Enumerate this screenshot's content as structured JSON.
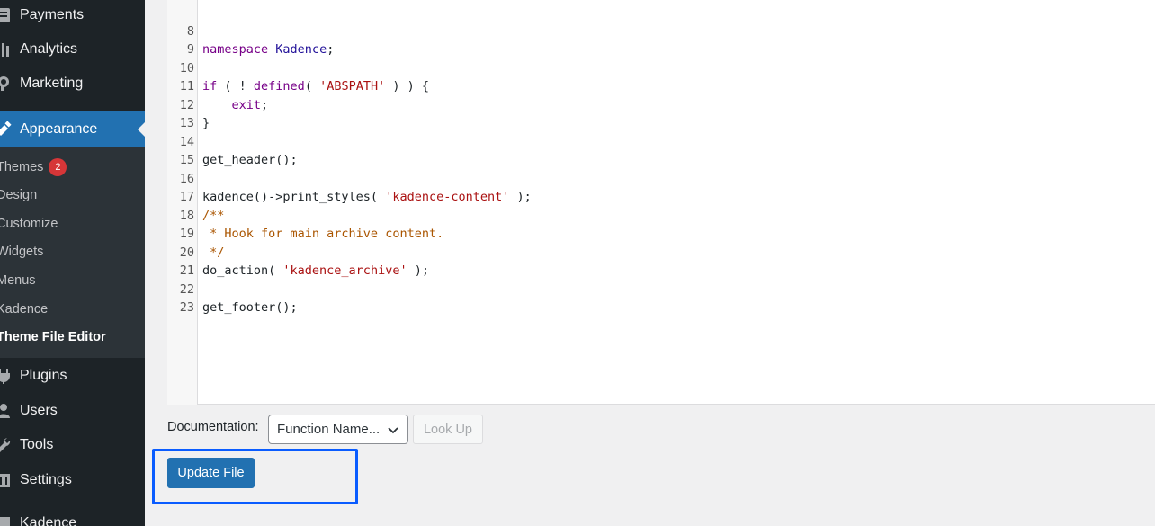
{
  "sidebar": {
    "items_top": [
      {
        "label": "Payments",
        "icon": "payments-icon"
      },
      {
        "label": "Analytics",
        "icon": "analytics-icon"
      },
      {
        "label": "Marketing",
        "icon": "marketing-icon"
      }
    ],
    "appearance": {
      "label": "Appearance",
      "icon": "appearance-brush-icon"
    },
    "submenu": [
      {
        "label": "Themes",
        "badge": "2"
      },
      {
        "label": "Design"
      },
      {
        "label": "Customize"
      },
      {
        "label": "Widgets"
      },
      {
        "label": "Menus"
      },
      {
        "label": "Kadence"
      },
      {
        "label": "Theme File Editor",
        "current": true
      }
    ],
    "items_bottom": [
      {
        "label": "Plugins",
        "icon": "plugins-icon"
      },
      {
        "label": "Users",
        "icon": "users-icon"
      },
      {
        "label": "Tools",
        "icon": "tools-icon"
      },
      {
        "label": "Settings",
        "icon": "settings-icon"
      },
      {
        "label": "Kadence",
        "icon": "kadence-icon"
      }
    ]
  },
  "editor": {
    "lines": [
      {
        "n": "8",
        "text": "namespace Kadence;"
      },
      {
        "n": "9",
        "text": ""
      },
      {
        "n": "10",
        "text": "if ( ! defined( 'ABSPATH' ) ) {"
      },
      {
        "n": "11",
        "text": "    exit;"
      },
      {
        "n": "12",
        "text": "}"
      },
      {
        "n": "13",
        "text": ""
      },
      {
        "n": "14",
        "text": "get_header();"
      },
      {
        "n": "15",
        "text": ""
      },
      {
        "n": "16",
        "text": "kadence()->print_styles( 'kadence-content' );"
      },
      {
        "n": "17",
        "text": "/**"
      },
      {
        "n": "18",
        "text": " * Hook for main archive content."
      },
      {
        "n": "19",
        "text": " */"
      },
      {
        "n": "20",
        "text": "do_action( 'kadence_archive' );"
      },
      {
        "n": "21",
        "text": ""
      },
      {
        "n": "22",
        "text": "get_footer();"
      },
      {
        "n": "23",
        "text": ""
      }
    ]
  },
  "documentation": {
    "label": "Documentation:",
    "select_value": "Function Name...",
    "lookup_label": "Look Up"
  },
  "update_label": "Update File",
  "colors": {
    "sidebar_bg": "#1d2327",
    "accent": "#2271b1",
    "badge": "#d63638",
    "highlight": "#0a5cff"
  }
}
